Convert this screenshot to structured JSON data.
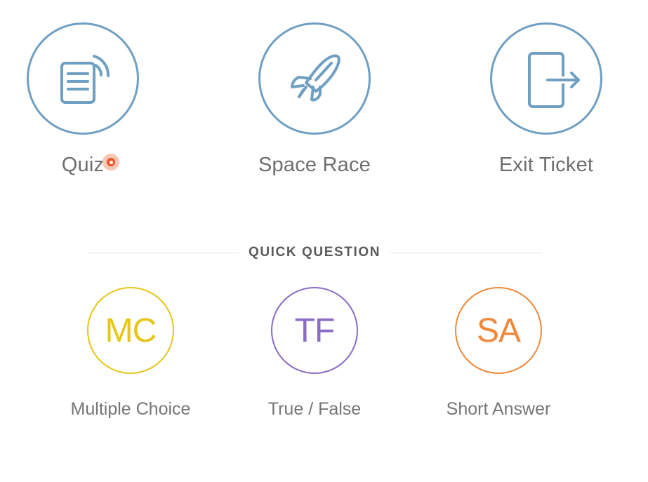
{
  "activities": [
    {
      "label": "Quiz",
      "icon": "quiz-document-icon"
    },
    {
      "label": "Space Race",
      "icon": "rocket-icon"
    },
    {
      "label": "Exit Ticket",
      "icon": "exit-door-icon"
    }
  ],
  "quick_question": {
    "title": "QUICK QUESTION",
    "items": [
      {
        "abbr": "MC",
        "label": "Multiple Choice",
        "color": "#e6c619"
      },
      {
        "abbr": "TF",
        "label": "True / False",
        "color": "#8a6cc7"
      },
      {
        "abbr": "SA",
        "label": "Short Answer",
        "color": "#f0883a"
      }
    ]
  },
  "colors": {
    "activity_ring": "#6f9fc2",
    "label_text": "#6e6e6e",
    "cursor_marker": "#e9542a"
  }
}
